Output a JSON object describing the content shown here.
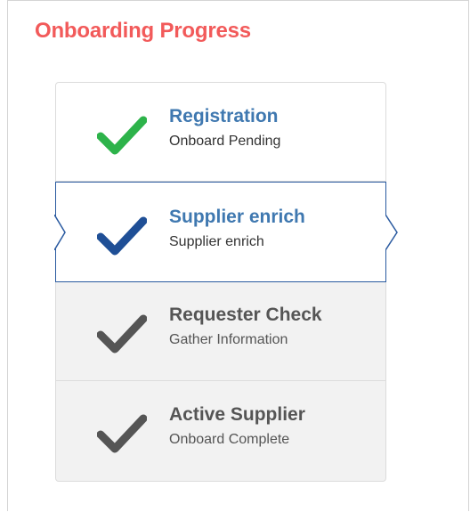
{
  "panel": {
    "title": "Onboarding Progress",
    "title_color": "#f25a5a"
  },
  "steps": [
    {
      "title": "Registration",
      "subtitle": "Onboard Pending",
      "state": "completed",
      "icon": "check-icon",
      "icon_color": "#2db34a"
    },
    {
      "title": "Supplier enrich",
      "subtitle": "Supplier enrich",
      "state": "current",
      "icon": "check-icon",
      "icon_color": "#1f4f96"
    },
    {
      "title": "Requester Check",
      "subtitle": "Gather Information",
      "state": "pending",
      "icon": "check-icon",
      "icon_color": "#555555"
    },
    {
      "title": "Active Supplier",
      "subtitle": "Onboard Complete",
      "state": "pending",
      "icon": "check-icon",
      "icon_color": "#555555"
    }
  ]
}
